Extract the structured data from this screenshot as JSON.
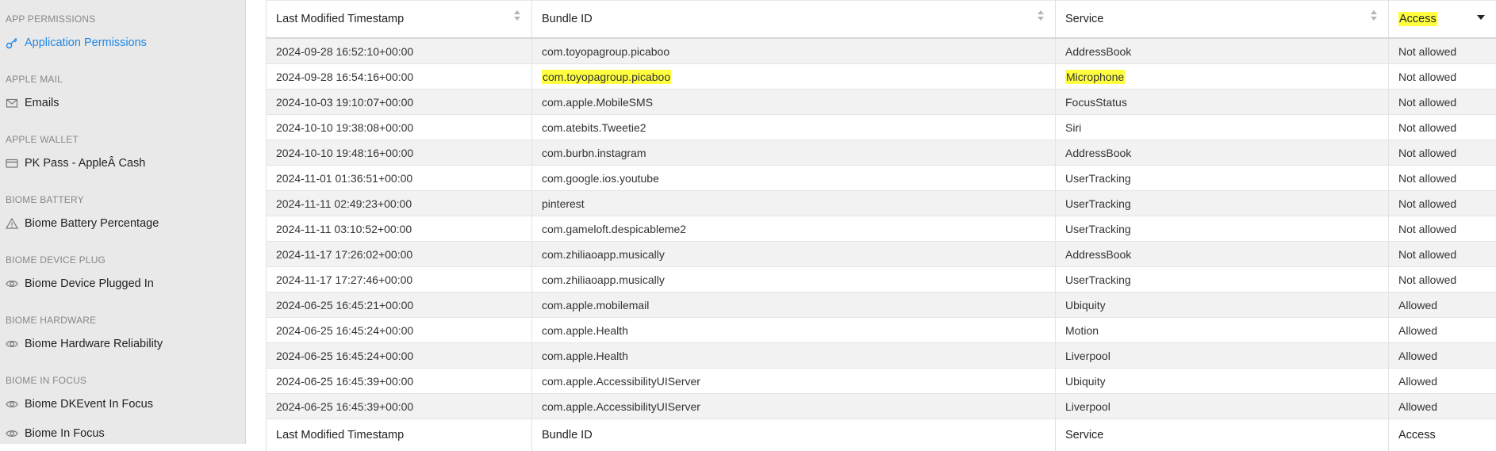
{
  "sidebar": {
    "sections": [
      {
        "title": "APP PERMISSIONS",
        "item": "Application Permissions",
        "icon": "key-icon",
        "active": true
      },
      {
        "title": "APPLE MAIL",
        "item": "Emails",
        "icon": "mail-icon",
        "active": false
      },
      {
        "title": "APPLE WALLET",
        "item": "PK Pass - AppleÂ Cash",
        "icon": "card-icon",
        "active": false
      },
      {
        "title": "BIOME BATTERY",
        "item": "Biome Battery Percentage",
        "icon": "warning-icon",
        "active": false
      },
      {
        "title": "BIOME DEVICE PLUG",
        "item": "Biome Device Plugged In",
        "icon": "eye-icon",
        "active": false
      },
      {
        "title": "BIOME HARDWARE",
        "item": "Biome Hardware Reliability",
        "icon": "eye-icon",
        "active": false
      },
      {
        "title": "BIOME IN FOCUS",
        "item": "Biome DKEvent In Focus",
        "icon": "eye-icon",
        "active": false
      }
    ],
    "extra_item": {
      "label": "Biome In Focus",
      "icon": "eye-icon"
    }
  },
  "table": {
    "columns": [
      "Last Modified Timestamp",
      "Bundle ID",
      "Service",
      "Access"
    ],
    "rows": [
      [
        "2024-09-28 16:52:10+00:00",
        "com.toyopagroup.picaboo",
        "AddressBook",
        "Not allowed"
      ],
      [
        "2024-09-28 16:54:16+00:00",
        "com.toyopagroup.picaboo",
        "Microphone",
        "Not allowed"
      ],
      [
        "2024-10-03 19:10:07+00:00",
        "com.apple.MobileSMS",
        "FocusStatus",
        "Not allowed"
      ],
      [
        "2024-10-10 19:38:08+00:00",
        "com.atebits.Tweetie2",
        "Siri",
        "Not allowed"
      ],
      [
        "2024-10-10 19:48:16+00:00",
        "com.burbn.instagram",
        "AddressBook",
        "Not allowed"
      ],
      [
        "2024-11-01 01:36:51+00:00",
        "com.google.ios.youtube",
        "UserTracking",
        "Not allowed"
      ],
      [
        "2024-11-11 02:49:23+00:00",
        "pinterest",
        "UserTracking",
        "Not allowed"
      ],
      [
        "2024-11-11 03:10:52+00:00",
        "com.gameloft.despicableme2",
        "UserTracking",
        "Not allowed"
      ],
      [
        "2024-11-17 17:26:02+00:00",
        "com.zhiliaoapp.musically",
        "AddressBook",
        "Not allowed"
      ],
      [
        "2024-11-17 17:27:46+00:00",
        "com.zhiliaoapp.musically",
        "UserTracking",
        "Not allowed"
      ],
      [
        "2024-06-25 16:45:21+00:00",
        "com.apple.mobilemail",
        "Ubiquity",
        "Allowed"
      ],
      [
        "2024-06-25 16:45:24+00:00",
        "com.apple.Health",
        "Motion",
        "Allowed"
      ],
      [
        "2024-06-25 16:45:24+00:00",
        "com.apple.Health",
        "Liverpool",
        "Allowed"
      ],
      [
        "2024-06-25 16:45:39+00:00",
        "com.apple.AccessibilityUIServer",
        "Ubiquity",
        "Allowed"
      ],
      [
        "2024-06-25 16:45:39+00:00",
        "com.apple.AccessibilityUIServer",
        "Liverpool",
        "Allowed"
      ]
    ],
    "sorted_column": "Access",
    "sort_direction": "descending",
    "highlight_color": "#ffff40",
    "accent_color": "#1e88e5"
  }
}
